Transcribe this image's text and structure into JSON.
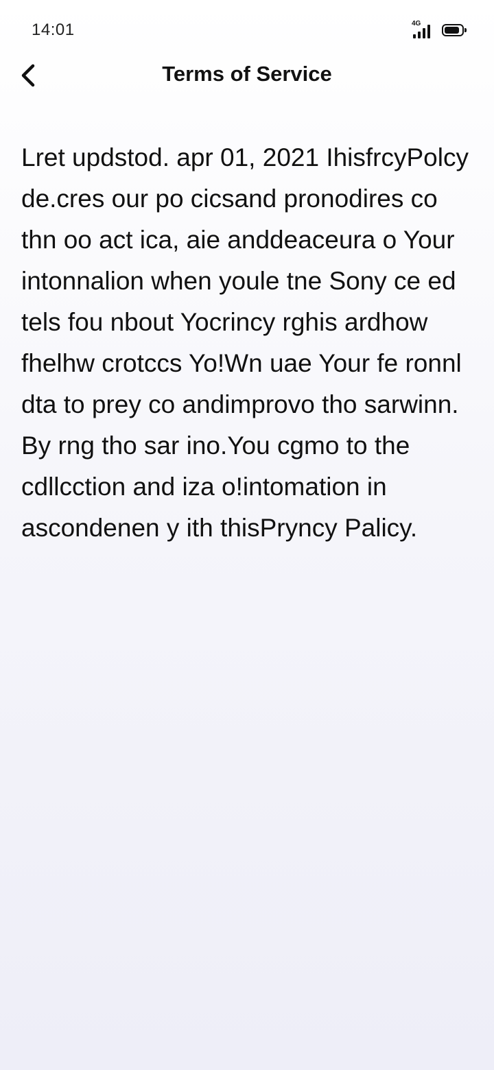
{
  "status_bar": {
    "time": "14:01",
    "network_label": "4G",
    "battery_level": 0.9,
    "icons": [
      "signal-icon",
      "battery-icon"
    ]
  },
  "header": {
    "title": "Terms of Service",
    "back_icon": "chevron-left-icon"
  },
  "body": {
    "text": "Lret updstod. apr 01, 2021 IhisfrcyPolcy de.cres our po cicsand pronodires co thn oo act ica, aie anddeaceura o Your intonnalion when youle tne Sony ce ed tels fou nbout Yocrincy rghis ardhow fhelhw crotccs Yo!Wn uae Your fe ronnl dta to prey co andimprovo tho sarwinn. By rng tho sar ino.You cgmo to the cdllcction and iza o!intomation in ascondenen y ith thisPryncy Palicy."
  },
  "colors": {
    "text": "#111111",
    "background_top": "#ffffff",
    "background_bottom": "#eeeef8"
  }
}
